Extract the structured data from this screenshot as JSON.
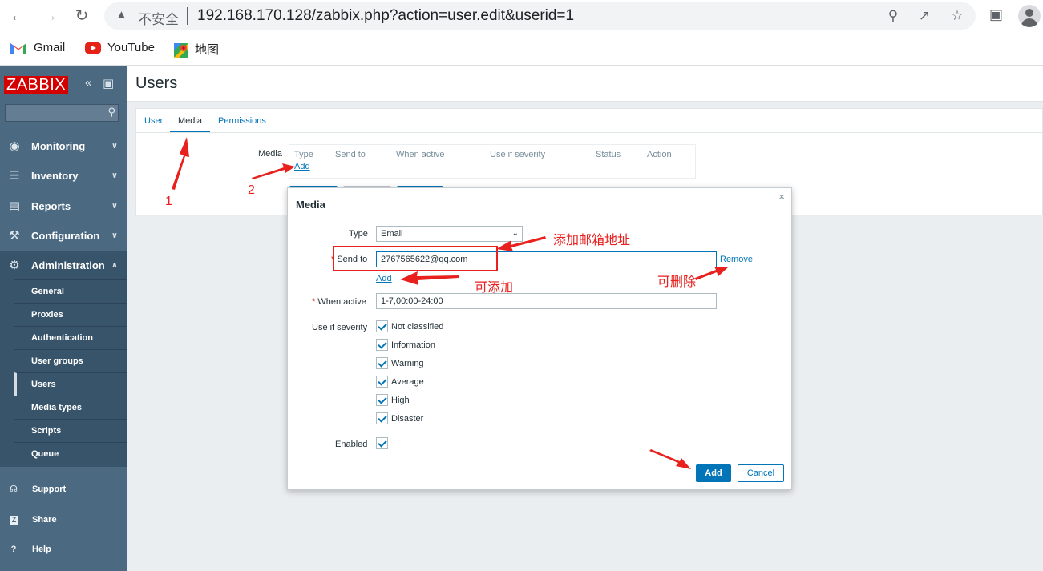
{
  "browser": {
    "insecure_label": "不安全",
    "url": "192.168.170.128/zabbix.php?action=user.edit&userid=1",
    "bookmarks": [
      {
        "label": "Gmail",
        "icon": "gmail-icon"
      },
      {
        "label": "YouTube",
        "icon": "youtube-icon"
      },
      {
        "label": "地图",
        "icon": "maps-icon"
      }
    ]
  },
  "sidebar": {
    "logo": "ZABBIX",
    "search_placeholder": "",
    "menu": [
      {
        "label": "Monitoring",
        "icon": "eye-icon"
      },
      {
        "label": "Inventory",
        "icon": "list-icon"
      },
      {
        "label": "Reports",
        "icon": "bar-chart-icon"
      },
      {
        "label": "Configuration",
        "icon": "wrench-icon"
      },
      {
        "label": "Administration",
        "icon": "gear-icon"
      }
    ],
    "admin_items": [
      "General",
      "Proxies",
      "Authentication",
      "User groups",
      "Users",
      "Media types",
      "Scripts",
      "Queue"
    ],
    "selected_admin_item": "Users",
    "bottom": [
      {
        "label": "Support",
        "icon": "headset-icon"
      },
      {
        "label": "Share",
        "icon": "share-z-icon"
      },
      {
        "label": "Help",
        "icon": "question-icon"
      }
    ]
  },
  "page": {
    "title": "Users",
    "tabs": [
      "User",
      "Media",
      "Permissions"
    ],
    "active_tab": "Media",
    "media_label": "Media",
    "media_table_headers": [
      "Type",
      "Send to",
      "When active",
      "Use if severity",
      "Status",
      "Action"
    ],
    "media_add_link": "Add"
  },
  "dialog": {
    "title": "Media",
    "type_label": "Type",
    "type_value": "Email",
    "send_to_label": "Send to",
    "send_to_value": "2767565622@qq.com",
    "remove_link": "Remove",
    "add_link": "Add",
    "when_active_label": "When active",
    "when_active_value": "1-7,00:00-24:00",
    "severity_label": "Use if severity",
    "severities": [
      "Not classified",
      "Information",
      "Warning",
      "Average",
      "High",
      "Disaster"
    ],
    "enabled_label": "Enabled",
    "add_button": "Add",
    "cancel_button": "Cancel"
  },
  "annotations": {
    "step1": "1",
    "step2": "2",
    "add_email": "添加邮箱地址",
    "can_add": "可添加",
    "can_delete": "可删除",
    "color": "#e8201e"
  },
  "colors": {
    "sidebar": "#4b6a82",
    "sidebar_active": "#37546a",
    "logo": "#d40000",
    "link": "#0275b8",
    "background": "#ebeef0"
  }
}
